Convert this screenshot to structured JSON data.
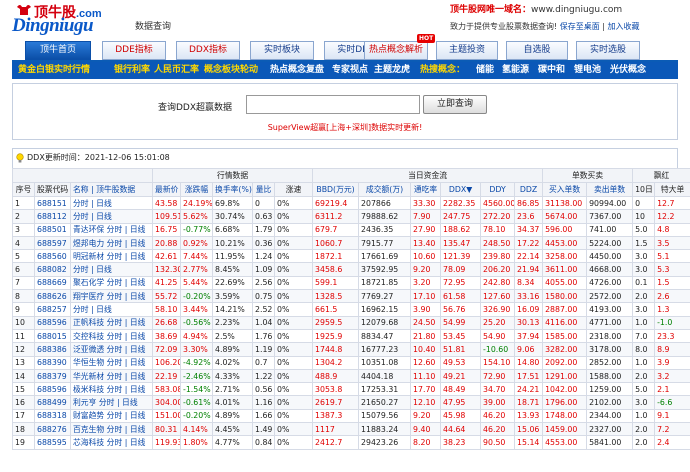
{
  "header": {
    "logo_cn": "顶牛股",
    "logo_dotcom": ".com",
    "logo_en": "Dingniugu",
    "logo_sub": "数据查询",
    "domain_notice_prefix": "顶牛股网唯一域名：",
    "domain": "www.dingniugu.com",
    "slogan": "致力于提供专业股票数据查询!",
    "save_desktop": "保存至桌面",
    "favorite": "加入收藏"
  },
  "nav": {
    "tabs": [
      "顶牛首页",
      "DDE指标",
      "DDX指标",
      "实时板块",
      "实时DDE",
      "热点概念解析",
      "主题投资",
      "自选股",
      "实时选股"
    ],
    "hot_badge": "HOT"
  },
  "subnav": {
    "items": [
      "黄金白银实时行情",
      "银行利率",
      "人民币汇率",
      "概念板块轮动",
      "热点概念复盘",
      "专家视点",
      "主题龙虎",
      "热搜概念：",
      "储能",
      "氢能源",
      "碳中和",
      "锂电池",
      "光伏概念"
    ]
  },
  "search": {
    "label": "查询DDX超赢数据",
    "value": "",
    "button": "立即查询",
    "note": "SuperView超赢[上海+深圳]数据实时更新!"
  },
  "update": {
    "text": "DDX更新时间：2021-12-06 15:01:08"
  },
  "table": {
    "group_headers": [
      "行情数据",
      "当日资金流",
      "单数买卖",
      "飘红"
    ],
    "columns": [
      "序号",
      "股票代码",
      "名称 | 顶牛股数据",
      "最新价",
      "涨跌幅",
      "换手率(%)",
      "量比",
      "涨速",
      "BBD(万元)",
      "成交额(万)",
      "通吃率",
      "DDX▼",
      "DDY",
      "DDZ",
      "买入单数",
      "卖出单数",
      "10日",
      "特大单"
    ],
    "rows": [
      [
        "1",
        "688151",
        "分时 | 日线",
        "43.58",
        "24.19%",
        "69.8%",
        "0",
        "0%",
        "69219.4",
        "207866",
        "33.30",
        "2282.35",
        "4560.00",
        "86.85",
        "31138.00",
        "90994.00",
        "0",
        "12.7"
      ],
      [
        "2",
        "688112",
        "分时 | 日线",
        "109.51",
        "5.62%",
        "30.74%",
        "0.63",
        "0%",
        "6311.2",
        "79888.62",
        "7.90",
        "247.75",
        "272.20",
        "23.6",
        "5674.00",
        "7367.00",
        "10",
        "12.2"
      ],
      [
        "3",
        "688501",
        "青达环保 分时 | 日线",
        "16.75",
        "-0.77%",
        "6.68%",
        "1.79",
        "0%",
        "679.7",
        "2436.35",
        "27.90",
        "188.62",
        "78.10",
        "34.37",
        "596.00",
        "741.00",
        "5.0",
        "4.8"
      ],
      [
        "4",
        "688597",
        "煜邦电力 分时 | 日线",
        "20.88",
        "0.92%",
        "10.21%",
        "0.36",
        "0%",
        "1060.7",
        "7915.77",
        "13.40",
        "135.47",
        "248.50",
        "17.22",
        "4453.00",
        "5224.00",
        "1.5",
        "3.5"
      ],
      [
        "5",
        "688560",
        "明冠新材 分时 | 日线",
        "42.61",
        "7.44%",
        "11.95%",
        "1.24",
        "0%",
        "1872.1",
        "17661.69",
        "10.60",
        "121.39",
        "239.80",
        "22.14",
        "3258.00",
        "4450.00",
        "3.0",
        "5.1"
      ],
      [
        "6",
        "688082",
        "分时 | 日线",
        "132.30",
        "2.77%",
        "8.45%",
        "1.09",
        "0%",
        "3458.6",
        "37592.95",
        "9.20",
        "78.09",
        "206.20",
        "21.94",
        "3611.00",
        "4668.00",
        "3.0",
        "5.3"
      ],
      [
        "7",
        "688669",
        "聚石化学 分时 | 日线",
        "41.25",
        "5.44%",
        "22.69%",
        "2.56",
        "0%",
        "599.1",
        "18721.85",
        "3.20",
        "72.95",
        "242.80",
        "8.34",
        "4055.00",
        "4726.00",
        "0.1",
        "1.5"
      ],
      [
        "8",
        "688626",
        "翔宇医疗 分时 | 日线",
        "55.72",
        "-0.20%",
        "3.59%",
        "0.75",
        "0%",
        "1328.5",
        "7769.27",
        "17.10",
        "61.58",
        "127.60",
        "33.16",
        "1580.00",
        "2572.00",
        "2.0",
        "2.6"
      ],
      [
        "9",
        "688257",
        "分时 | 日线",
        "58.10",
        "3.44%",
        "14.21%",
        "2.52",
        "0%",
        "661.5",
        "16962.15",
        "3.90",
        "56.76",
        "326.90",
        "16.09",
        "2887.00",
        "4193.00",
        "3.0",
        "1.3"
      ],
      [
        "10",
        "688596",
        "正帆科技 分时 | 日线",
        "26.68",
        "-0.56%",
        "2.23%",
        "1.04",
        "0%",
        "2959.5",
        "12079.68",
        "24.50",
        "54.99",
        "25.20",
        "30.13",
        "4116.00",
        "4771.00",
        "1.0",
        "-1.0"
      ],
      [
        "11",
        "688015",
        "交控科技 分时 | 日线",
        "38.69",
        "4.94%",
        "2.5%",
        "1.76",
        "0%",
        "1925.9",
        "8834.47",
        "21.80",
        "53.45",
        "54.90",
        "37.94",
        "1585.00",
        "2318.00",
        "7.0",
        "23.3"
      ],
      [
        "12",
        "688386",
        "泛亚微透 分时 | 日线",
        "72.09",
        "3.30%",
        "4.89%",
        "1.19",
        "0%",
        "1744.8",
        "16777.23",
        "10.40",
        "51.81",
        "-10.60",
        "9.06",
        "3282.00",
        "3178.00",
        "8.0",
        "8.9"
      ],
      [
        "13",
        "688390",
        "华恒生物 分时 | 日线",
        "106.20",
        "-4.92%",
        "4.02%",
        "0.7",
        "0%",
        "1304.2",
        "10351.08",
        "12.60",
        "49.53",
        "154.10",
        "14.80",
        "2092.00",
        "2852.00",
        "1.0",
        "3.9"
      ],
      [
        "14",
        "688379",
        "华光新材 分时 | 日线",
        "22.19",
        "-2.46%",
        "4.33%",
        "1.22",
        "0%",
        "488.9",
        "4404.18",
        "11.10",
        "49.21",
        "72.90",
        "17.51",
        "1291.00",
        "1588.00",
        "2.0",
        "3.2"
      ],
      [
        "15",
        "688596",
        "极米科技 分时 | 日线",
        "583.08",
        "-1.54%",
        "2.71%",
        "0.56",
        "0%",
        "3053.8",
        "17253.31",
        "17.70",
        "48.49",
        "34.70",
        "24.21",
        "1042.00",
        "1259.00",
        "5.0",
        "2.1"
      ],
      [
        "16",
        "688499",
        "利元亨 分时 | 日线",
        "304.00",
        "-0.61%",
        "4.01%",
        "1.16",
        "0%",
        "2619.7",
        "21650.27",
        "12.10",
        "47.95",
        "39.00",
        "18.71",
        "1796.00",
        "2102.00",
        "3.0",
        "-6.6"
      ],
      [
        "17",
        "688318",
        "财富趋势 分时 | 日线",
        "151.00",
        "-0.20%",
        "4.89%",
        "1.66",
        "0%",
        "1387.3",
        "15079.56",
        "9.20",
        "45.98",
        "46.20",
        "13.93",
        "1748.00",
        "2344.00",
        "1.0",
        "9.1"
      ],
      [
        "18",
        "688276",
        "百克生物 分时 | 日线",
        "80.31",
        "4.14%",
        "4.45%",
        "1.49",
        "0%",
        "1117",
        "11883.24",
        "9.40",
        "44.64",
        "46.20",
        "15.06",
        "1459.00",
        "2327.00",
        "2.0",
        "7.2"
      ],
      [
        "19",
        "688595",
        "芯海科技 分时 | 日线",
        "119.93",
        "1.80%",
        "4.77%",
        "0.84",
        "0%",
        "2412.7",
        "29423.26",
        "8.20",
        "38.23",
        "90.50",
        "15.14",
        "4553.00",
        "5841.00",
        "2.0",
        "2.4"
      ]
    ]
  },
  "colors": {
    "accent": "#0b58b8",
    "up": "#e00000",
    "down": "#008000",
    "link": "#0a48a8"
  }
}
